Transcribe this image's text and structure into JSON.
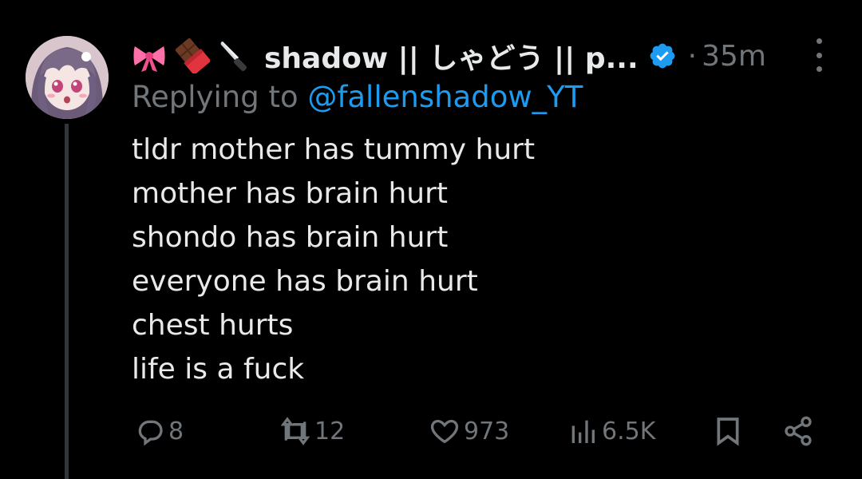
{
  "tweet": {
    "display_name": "shadow || しゃどう || p...",
    "emojis": [
      "ribbon-emoji",
      "chocolate-bar-emoji",
      "kitchen-knife-emoji"
    ],
    "dot": "·",
    "time": "35m",
    "replying_prefix": "Replying to ",
    "replying_handle": "@fallenshadow_YT",
    "lines": [
      "tldr mother has tummy hurt",
      "mother has brain hurt",
      "shondo has brain hurt",
      "everyone has brain hurt",
      "chest hurts",
      "life is a fuck"
    ],
    "actions": {
      "replies": "8",
      "reposts": "12",
      "likes": "973",
      "views": "6.5K"
    }
  },
  "colors": {
    "background": "#000000",
    "text": "#e7e9ea",
    "muted": "#71767b",
    "accent": "#1d9bf0",
    "thread_line": "#333639"
  },
  "icons": {
    "more": "more-vertical-icon",
    "verified": "verified-badge-icon",
    "reply": "reply-icon",
    "repost": "repost-icon",
    "like": "heart-icon",
    "views": "views-icon",
    "bookmark": "bookmark-icon",
    "share": "share-icon"
  }
}
